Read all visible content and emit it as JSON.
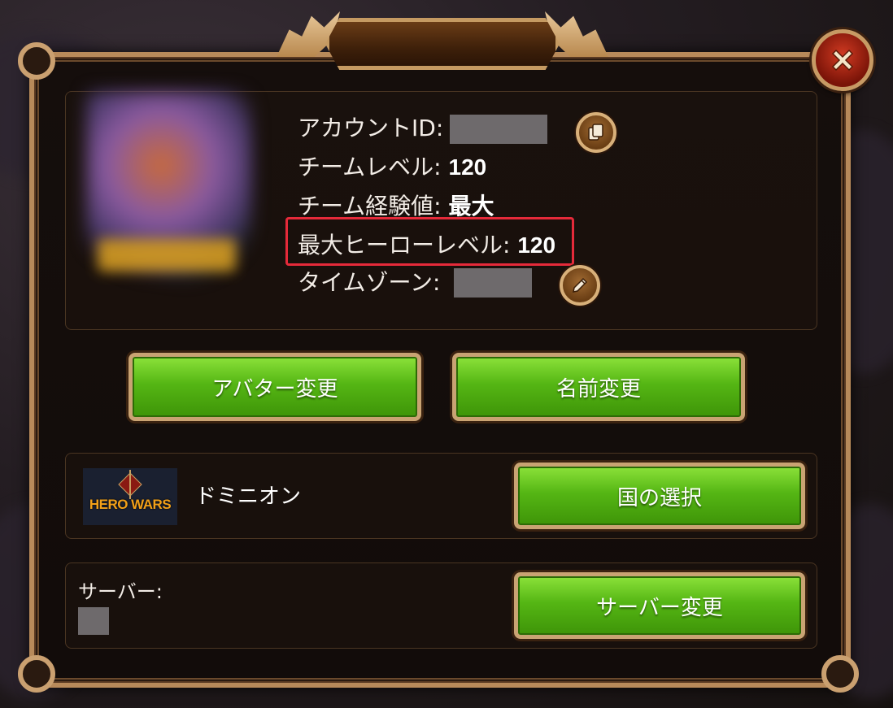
{
  "profile": {
    "account_id_label": "アカウントID:",
    "team_level_label": "チームレベル:",
    "team_level_value": "120",
    "team_exp_label": "チーム経験値:",
    "team_exp_value": "最大",
    "max_hero_level_label": "最大ヒーローレベル:",
    "max_hero_level_value": "120",
    "timezone_label": "タイムゾーン:"
  },
  "buttons": {
    "change_avatar": "アバター変更",
    "change_name": "名前変更",
    "select_country": "国の選択",
    "change_server": "サーバー変更"
  },
  "guild": {
    "logo_text": "HERO WARS",
    "name": "ドミニオン"
  },
  "server": {
    "label": "サーバー:"
  },
  "icons": {
    "copy": "copy-icon",
    "edit": "pencil-icon",
    "close": "close-icon"
  },
  "colors": {
    "highlight": "#e52a3a",
    "button_green": "#55b614",
    "frame_gold": "#b88a5a"
  }
}
